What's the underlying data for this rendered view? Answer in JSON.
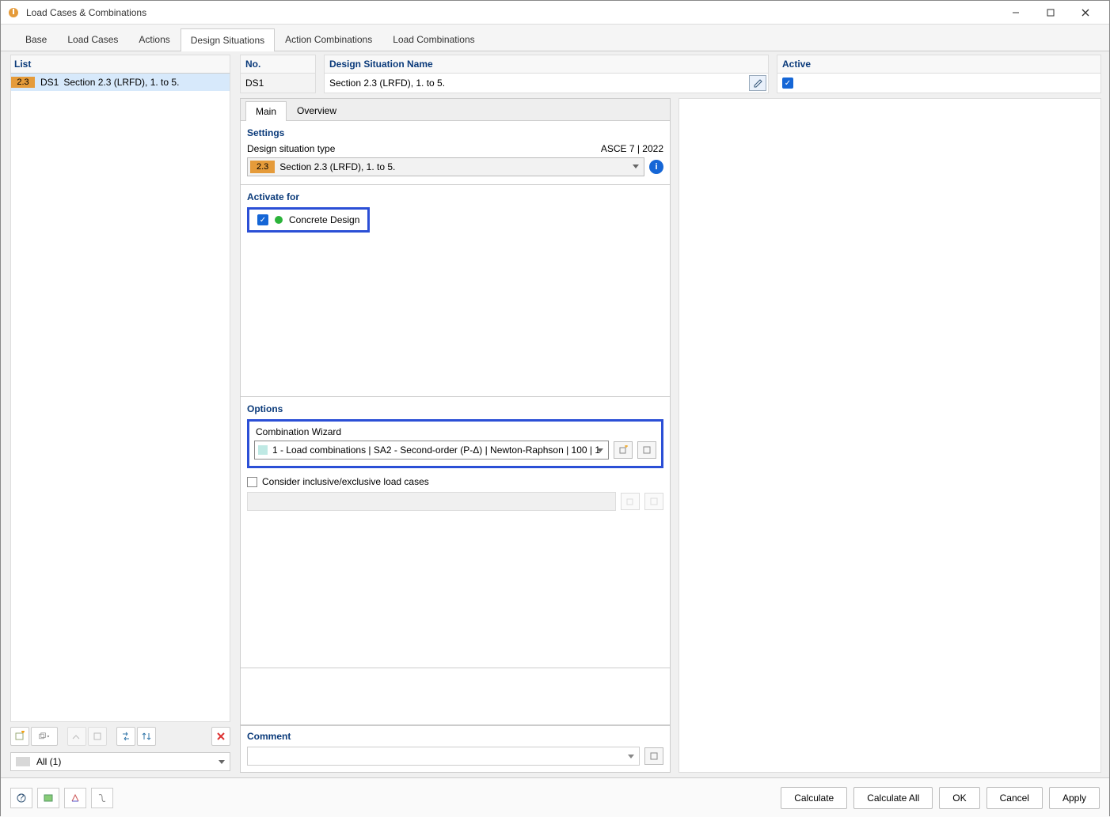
{
  "window": {
    "title": "Load Cases & Combinations"
  },
  "main_tabs": [
    "Base",
    "Load Cases",
    "Actions",
    "Design Situations",
    "Action Combinations",
    "Load Combinations"
  ],
  "main_tabs_active_index": 3,
  "left": {
    "header": "List",
    "items": [
      {
        "badge": "2.3",
        "code": "DS1",
        "desc": "Section 2.3 (LRFD), 1. to 5."
      }
    ],
    "filter": "All (1)"
  },
  "fields": {
    "no_label": "No.",
    "no_value": "DS1",
    "name_label": "Design Situation Name",
    "name_value": "Section 2.3 (LRFD), 1. to 5.",
    "active_label": "Active",
    "active_checked": true
  },
  "sub_tabs": [
    "Main",
    "Overview"
  ],
  "sub_tabs_active_index": 0,
  "settings": {
    "title": "Settings",
    "type_label": "Design situation type",
    "standard": "ASCE 7 | 2022",
    "type_badge": "2.3",
    "type_value": "Section 2.3 (LRFD), 1. to 5."
  },
  "activate": {
    "title": "Activate for",
    "item_label": "Concrete Design",
    "item_checked": true
  },
  "options": {
    "title": "Options",
    "cw_label": "Combination Wizard",
    "cw_value": "1 - Load combinations | SA2 - Second-order (P-Δ) | Newton-Raphson | 100 | 1",
    "consider_label": "Consider inclusive/exclusive load cases",
    "consider_checked": false
  },
  "comment": {
    "title": "Comment",
    "value": ""
  },
  "footer": {
    "calculate": "Calculate",
    "calculate_all": "Calculate All",
    "ok": "OK",
    "cancel": "Cancel",
    "apply": "Apply"
  }
}
